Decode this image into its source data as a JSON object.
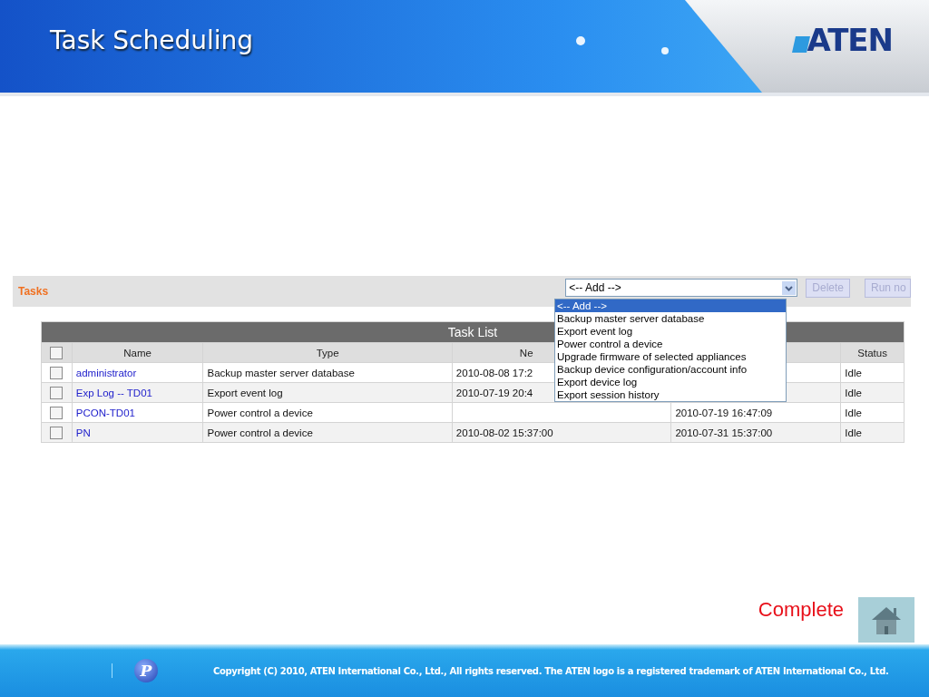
{
  "header": {
    "title": "Task Scheduling",
    "logo": "ATEN"
  },
  "tasks_bar": {
    "label": "Tasks",
    "select": {
      "value": "<-- Add -->",
      "expanded": true,
      "options": [
        {
          "label": "<-- Add -->",
          "selected": true
        },
        {
          "label": "Backup master server database",
          "selected": false
        },
        {
          "label": "Export event log",
          "selected": false
        },
        {
          "label": "Power control a device",
          "selected": false
        },
        {
          "label": "Upgrade firmware of selected appliances",
          "selected": false
        },
        {
          "label": "Backup device configuration/account info",
          "selected": false
        },
        {
          "label": "Export device log",
          "selected": false
        },
        {
          "label": "Export session history",
          "selected": false
        }
      ]
    },
    "buttons": [
      {
        "label": "Delete",
        "disabled": true
      },
      {
        "label": "Run no",
        "disabled": true
      }
    ]
  },
  "table": {
    "title": "Task List",
    "select_all": {
      "checked": false
    },
    "columns": [
      "Name",
      "Type",
      "Ne",
      "",
      "Status"
    ],
    "rows": [
      {
        "checked": false,
        "name": "administrator",
        "type": "Backup master server database",
        "column_4": "2010-08-08 17:2",
        "column_5": "",
        "status": "Idle"
      },
      {
        "checked": false,
        "name": "Exp Log -- TD01",
        "type": "Export event log",
        "column_4": "2010-07-19 20:4",
        "column_5": "",
        "status": "Idle"
      },
      {
        "checked": false,
        "name": "PCON-TD01",
        "type": "Power control a device",
        "column_4": "",
        "column_5": "2010-07-19 16:47:09",
        "status": "Idle"
      },
      {
        "checked": false,
        "name": "PN",
        "type": "Power control a device",
        "column_4": "2010-08-02 15:37:00",
        "column_5": "2010-07-31 15:37:00",
        "status": "Idle"
      }
    ]
  },
  "complete_label": "Complete",
  "footer": {
    "badge": "P",
    "copyright": "Copyright (C) 2010, ATEN International Co., Ltd., All rights reserved. The ATEN logo is a registered trademark of ATEN International Co., Ltd."
  }
}
